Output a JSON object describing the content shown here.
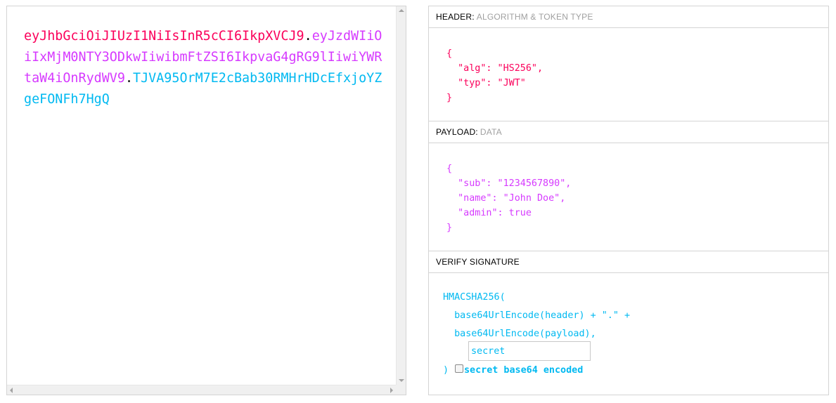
{
  "encoded": {
    "header": "eyJhbGciOiJIUzI1NiIsInR5cCI6IkpXVCJ9",
    "payload": "eyJzdWIiOiIxMjM0NTY3ODkwIiwibmFtZSI6IkpvaG4gRG9lIiwiYWRtaW4iOnRydWV9",
    "signature": "TJVA95OrM7E2cBab30RMHrHDcEfxjoYZgeFONFh7HgQ",
    "dot": "."
  },
  "header_panel": {
    "title": "HEADER:",
    "subtitle": "ALGORITHM & TOKEN TYPE",
    "code": "{\n  \"alg\": \"HS256\",\n  \"typ\": \"JWT\"\n}"
  },
  "payload_panel": {
    "title": "PAYLOAD:",
    "subtitle": "DATA",
    "code": "{\n  \"sub\": \"1234567890\",\n  \"name\": \"John Doe\",\n  \"admin\": true\n}"
  },
  "verify_panel": {
    "title": "VERIFY SIGNATURE",
    "line1": "HMACSHA256(",
    "line2": "  base64UrlEncode(header) + \".\" +",
    "line3": "  base64UrlEncode(payload),",
    "secret_placeholder": "secret",
    "close_paren": ")",
    "checkbox_label": "secret base64 encoded"
  },
  "colors": {
    "header": "#fb015b",
    "payload": "#d63aff",
    "signature": "#00b9f1"
  }
}
